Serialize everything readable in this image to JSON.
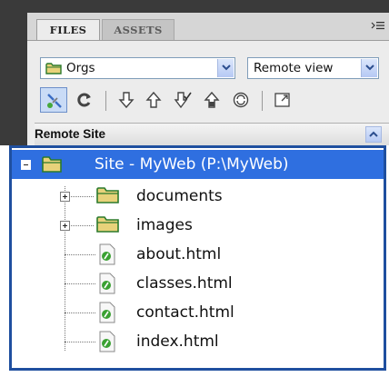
{
  "panel": {
    "tabs": [
      {
        "label": "FILES",
        "active": true
      },
      {
        "label": "ASSETS",
        "active": false
      }
    ],
    "menu_icon": "panel-menu-icon"
  },
  "site_select": {
    "value": "Orgs"
  },
  "view_select": {
    "value": "Remote view"
  },
  "toolbar": {
    "buttons": [
      {
        "icon": "connect-icon",
        "pressed": true
      },
      {
        "icon": "refresh-icon"
      },
      {
        "icon": "get-files-icon"
      },
      {
        "icon": "put-files-icon"
      },
      {
        "icon": "check-out-icon"
      },
      {
        "icon": "check-in-icon"
      },
      {
        "icon": "synchronize-icon"
      },
      {
        "icon": "expand-icon"
      }
    ]
  },
  "column_header": {
    "label": "Remote Site"
  },
  "tree": {
    "root": {
      "label": "Site - MyWeb (P:\\MyWeb)",
      "expanded": true,
      "selected": true
    },
    "folders": [
      {
        "label": "documents"
      },
      {
        "label": "images"
      }
    ],
    "files": [
      {
        "label": "about.html"
      },
      {
        "label": "classes.html"
      },
      {
        "label": "contact.html"
      },
      {
        "label": "index.html"
      }
    ]
  },
  "colors": {
    "selection": "#2f6fe0",
    "popup_border": "#1f4f9f",
    "frame": "#3a3a3a",
    "folder": "#e8d27a",
    "file_icon_green": "#3aa132"
  }
}
